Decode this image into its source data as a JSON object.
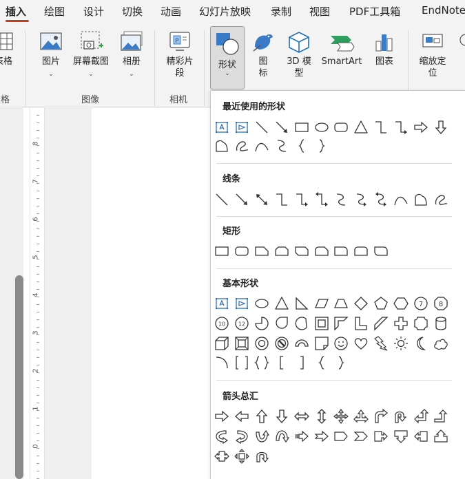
{
  "tabs": [
    "插入",
    "绘图",
    "设计",
    "切换",
    "动画",
    "幻灯片放映",
    "录制",
    "视图",
    "PDF工具箱",
    "EndNote"
  ],
  "ribbon": {
    "table_label": "表格",
    "table_group": "表格",
    "picture": "图片",
    "screenshot": "屏幕截图",
    "album": "相册",
    "images_group": "图像",
    "clip": "精彩片段",
    "camera_group": "相机",
    "shapes": "形状",
    "icons": "图标",
    "model3d": "3D 模型",
    "smartart": "SmartArt",
    "chart": "图表",
    "zoom": "缩放定位"
  },
  "ruler": [
    "8",
    "7",
    "6",
    "5",
    "4",
    "3",
    "2",
    "1",
    "0"
  ],
  "panel": {
    "recent_title": "最近使用的形状",
    "lines_title": "线条",
    "rect_title": "矩形",
    "basic_title": "基本形状",
    "arrows_title": "箭头总汇"
  },
  "colors": {
    "accent": "#c43e1c",
    "textbox_blue": "#2b6cb0"
  }
}
